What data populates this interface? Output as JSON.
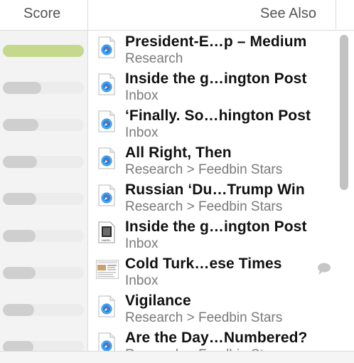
{
  "header": {
    "score_label": "Score",
    "see_also_label": "See Also"
  },
  "colors": {
    "top_score_fill": "#c4d98b",
    "score_fill": "#cfcfcf",
    "safari_blue": "#1e88e5"
  },
  "rows": [
    {
      "title": "President-E…p – Medium",
      "subtitle": "Research",
      "icon": "safari-webloc-icon",
      "score": 1.0
    },
    {
      "title": "Inside the g…ington Post",
      "subtitle": "Inbox",
      "icon": "safari-webloc-icon",
      "score": 0.47
    },
    {
      "title": "‘Finally. So…hington Post",
      "subtitle": "Inbox",
      "icon": "safari-webloc-icon",
      "score": 0.44
    },
    {
      "title": "All Right, Then",
      "subtitle": "Research > Feedbin Stars",
      "icon": "safari-webloc-icon",
      "score": 0.42
    },
    {
      "title": "Russian ‘Du…Trump Win",
      "subtitle": "Research > Feedbin Stars",
      "icon": "safari-webloc-icon",
      "score": 0.41
    },
    {
      "title": "Inside the g…ington Post",
      "subtitle": "Inbox",
      "icon": "markdown-document-icon",
      "score": 0.4,
      "icon_caption": "MARK↓"
    },
    {
      "title": "Cold Turk…ese Times",
      "subtitle": "Inbox",
      "icon": "webpage-thumbnail-icon",
      "score": 0.4,
      "comment_icon": "speech-bubble-icon"
    },
    {
      "title": "Vigilance",
      "subtitle": "Research > Feedbin Stars",
      "icon": "safari-webloc-icon",
      "score": 0.39
    },
    {
      "title": "Are the Day…Numbered?",
      "subtitle": "Research > Feedbin Stars",
      "icon": "safari-webloc-icon",
      "score": 0.38
    }
  ]
}
